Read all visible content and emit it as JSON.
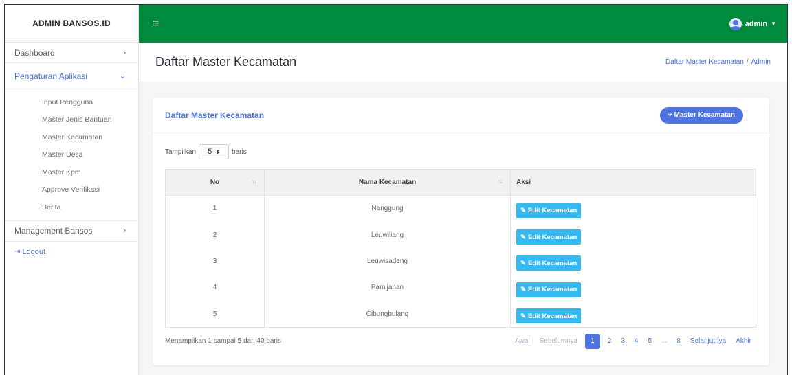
{
  "sidebar": {
    "brand": "ADMIN BANSOS.ID",
    "items": [
      {
        "label": "Dashboard",
        "chevron": "›"
      },
      {
        "label": "Pengaturan Aplikasi",
        "chevron": "⌄"
      },
      {
        "label": "Management Bansos",
        "chevron": "›"
      }
    ],
    "submenu": [
      "Input Pengguna",
      "Master Jenis Bantuan",
      "Master Kecamatan",
      "Master Desa",
      "Master Kpm",
      "Approve Verifikasi",
      "Berita"
    ],
    "logout_label": "Logout"
  },
  "topbar": {
    "menu_icon": "≡",
    "user_name": "admin"
  },
  "page": {
    "title": "Daftar Master Kecamatan",
    "breadcrumb": [
      "Daftar Master Kecamatan",
      "Admin"
    ]
  },
  "card": {
    "title": "Daftar Master Kecamatan",
    "add_button": "Master Kecamatan",
    "length_prefix": "Tampilkan",
    "length_value": "5",
    "length_suffix": "baris",
    "columns": [
      "No",
      "Nama Kecamatan",
      "Aksi"
    ],
    "rows": [
      {
        "no": "1",
        "name": "Nanggung"
      },
      {
        "no": "2",
        "name": "Leuwiliang"
      },
      {
        "no": "3",
        "name": "Leuwisadeng"
      },
      {
        "no": "4",
        "name": "Pamijahan"
      },
      {
        "no": "5",
        "name": "Cibungbulang"
      }
    ],
    "edit_label": "Edit Kecamatan",
    "info": "Menampilkan 1 sampai 5 dari 40 baris",
    "pager": {
      "first": "Awal",
      "prev": "Sebelumnya",
      "pages": [
        "1",
        "2",
        "3",
        "4",
        "5",
        "...",
        "8"
      ],
      "next": "Selanjutnya",
      "last": "Akhir"
    }
  },
  "colors": {
    "topbar": "#008a3e",
    "accent": "#4e73df",
    "edit_button": "#36b9f0"
  }
}
